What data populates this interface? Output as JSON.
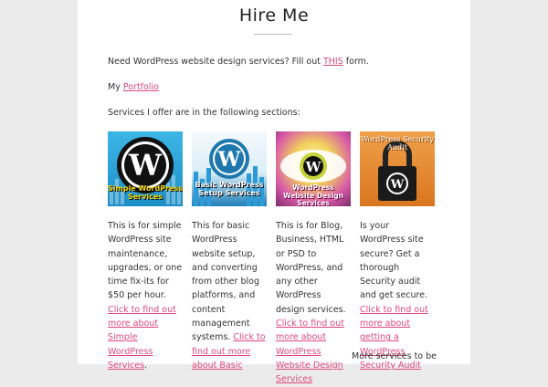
{
  "page": {
    "title": "Hire Me",
    "intro_text": "Need WordPress website design services? Fill out ",
    "intro_link": "THIS",
    "intro_suffix": " form.",
    "portfolio_prefix": "My ",
    "portfolio_link": "Portfolio",
    "services_intro": "Services I offer are in the following sections:"
  },
  "services": [
    {
      "image_caption": "Simple WordPress Services",
      "text": "This is for simple WordPress site maintenance, upgrades, or one time fix-its for $50 per hour. ",
      "link": "Click to find out more about Simple WordPress Services",
      "suffix": "."
    },
    {
      "image_caption": "Basic WordPress Setup Services",
      "text": "This for basic WordPress website setup, and converting from other blog platforms, and content management systems. ",
      "link": "Click to find out more about Basic",
      "suffix": ""
    },
    {
      "image_caption": "WordPress Website Design Services",
      "text": "This is for Blog, Business, HTML or PSD to WordPress, and any other WordPress design services. ",
      "link": "Click to find out more about WordPress Website Design Services",
      "suffix": ""
    },
    {
      "image_caption": "WordPress Security Audit",
      "text": "Is your WordPress site secure? Get a thorough Security audit and get secure. ",
      "link": "Click to find out more about getting a WordPress Security Audit",
      "suffix": ""
    }
  ],
  "more_services": "More services to be",
  "colors": {
    "background": "#ebebeb",
    "content": "#ffffff",
    "link": "#e0477d",
    "thumb1_bg": "#2aa3d8",
    "thumb2_bg": "#1f7fb8",
    "thumb3_bg": "#f3e7b8",
    "thumb4_bg": "#e88a3a"
  },
  "icons": [
    "wordpress-logo-icon",
    "padlock-icon"
  ]
}
